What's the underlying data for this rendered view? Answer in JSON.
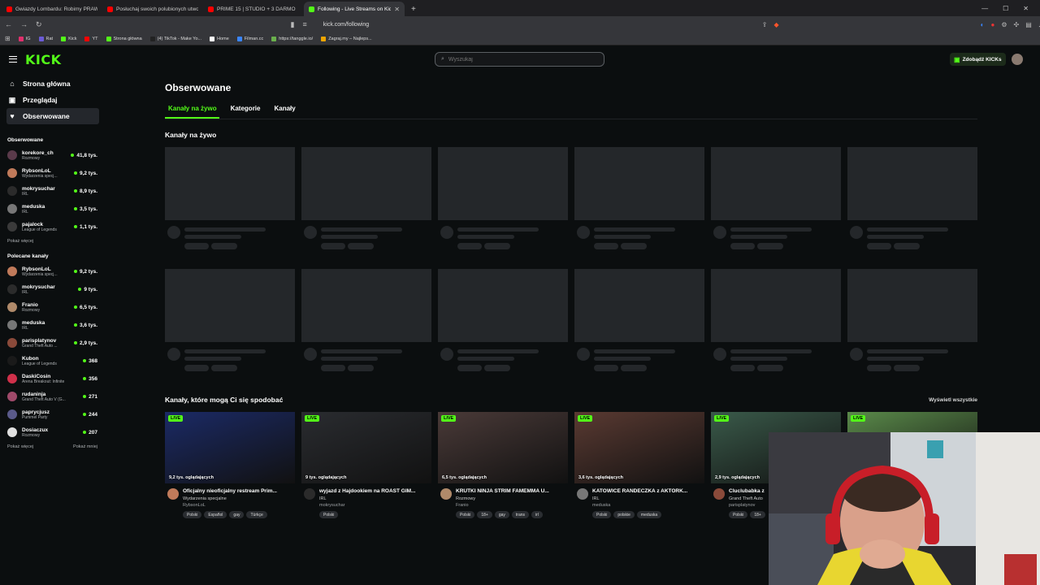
{
  "browser": {
    "tabs": [
      {
        "title": "Gwiazdy Lombardu: Robimy PRAWO",
        "color": "#ff0000",
        "active": false
      },
      {
        "title": "Posłuchaj swoich polubionych utwo",
        "color": "#ff0000",
        "active": false
      },
      {
        "title": "PRIME 15 | STUDIO + 3 DARMO",
        "color": "#ff0000",
        "active": false
      },
      {
        "title": "Following - Live Streams on Kick",
        "color": "#53fc18",
        "active": true
      }
    ],
    "url": "kick.com/following",
    "bookmarks": [
      {
        "label": "IG",
        "color": "#e1306c"
      },
      {
        "label": "Rat",
        "color": "#6b5bd6"
      },
      {
        "label": "Kick",
        "color": "#53fc18"
      },
      {
        "label": "YT",
        "color": "#ff0000"
      },
      {
        "label": "Strona główna",
        "color": "#53fc18"
      },
      {
        "label": "(4) TikTok - Make Yo...",
        "color": "#222222"
      },
      {
        "label": "Home",
        "color": "#ffffff"
      },
      {
        "label": "Filman.cc",
        "color": "#3a86ff"
      },
      {
        "label": "https://tanggle.io/",
        "color": "#6ab04c"
      },
      {
        "label": "Zagraj.my – Najleps...",
        "color": "#f0a500"
      }
    ]
  },
  "header": {
    "logo": "KICK",
    "search_placeholder": "Wyszukaj",
    "kicks_button": "Zdobądź KICKs"
  },
  "sidebar": {
    "nav": [
      {
        "label": "Strona główna",
        "icon": "home-icon",
        "glyph": "⌂",
        "active": false
      },
      {
        "label": "Przeglądaj",
        "icon": "browse-icon",
        "glyph": "▣",
        "active": false
      },
      {
        "label": "Obserwowane",
        "icon": "heart-icon",
        "glyph": "♥",
        "active": true
      }
    ],
    "followed_title": "Obserwowane",
    "followed": [
      {
        "name": "korekore_ch",
        "category": "Rozmowy",
        "viewers": "41,8 tys.",
        "color": "#5a3a4a"
      },
      {
        "name": "RybsonLoL",
        "category": "Wydarzenia specj...",
        "viewers": "9,2 tys.",
        "color": "#c07a5a"
      },
      {
        "name": "mokrysuchar",
        "category": "IRL",
        "viewers": "8,9 tys.",
        "color": "#2b2b2b"
      },
      {
        "name": "meduska",
        "category": "IRL",
        "viewers": "3,5 tys.",
        "color": "#777777"
      },
      {
        "name": "pajalock",
        "category": "League of Legends",
        "viewers": "1,1 tys.",
        "color": "#3a3a3a"
      }
    ],
    "followed_more": "Pokaż więcej",
    "recommended_title": "Polecane kanały",
    "recommended": [
      {
        "name": "RybsonLoL",
        "category": "Wydarzenia specj...",
        "viewers": "9,2 tys.",
        "color": "#c07a5a"
      },
      {
        "name": "mokrysuchar",
        "category": "IRL",
        "viewers": "9 tys.",
        "color": "#2b2b2b"
      },
      {
        "name": "Franio",
        "category": "Rozmowy",
        "viewers": "6,5 tys.",
        "color": "#b08a6a"
      },
      {
        "name": "meduska",
        "category": "IRL",
        "viewers": "3,6 tys.",
        "color": "#777777"
      },
      {
        "name": "parisplatynov",
        "category": "Grand Theft Auto ...",
        "viewers": "2,9 tys.",
        "color": "#8a4a3a"
      },
      {
        "name": "Kubon",
        "category": "League of Legends",
        "viewers": "368",
        "color": "#1a1a1a"
      },
      {
        "name": "DaskiCosin",
        "category": "Arena Breakout: Infinite",
        "viewers": "356",
        "color": "#d0304a"
      },
      {
        "name": "rudaninja",
        "category": "Grand Theft Auto V (G...",
        "viewers": "271",
        "color": "#a04a6a"
      },
      {
        "name": "paprycjusz",
        "category": "Pummel Party",
        "viewers": "244",
        "color": "#5a5a8a"
      },
      {
        "name": "Dosiaczux",
        "category": "Rozmowy",
        "viewers": "207",
        "color": "#e0e0e0"
      }
    ],
    "recommended_more": "Pokaż więcej",
    "recommended_less": "Pokaż mniej"
  },
  "main": {
    "title": "Obserwowane",
    "tabs": [
      "Kanały na żywo",
      "Kategorie",
      "Kanały"
    ],
    "live_section_title": "Kanały na żywo",
    "reco_section_title": "Kanały, które mogą Ci się spodobać",
    "see_all": "Wyświetl wszystkie",
    "live_badge": "LIVE",
    "cards": [
      {
        "views": "9,2 tys. oglądających",
        "title": "Oficjalny nieoficjalny restream Prim...",
        "category": "Wydarzenia specjalne",
        "channel": "RybsonLoL",
        "tags": [
          "Polski",
          "Español",
          "gay",
          "Türkçe"
        ],
        "avatar": "#c07a5a",
        "thumb": "#1b2a66"
      },
      {
        "views": "9 tys. oglądających",
        "title": "wyjazd z Hajdookiem na ROAST GIM...",
        "category": "IRL",
        "channel": "mokrysuchar",
        "tags": [
          "Polski"
        ],
        "avatar": "#2b2b2b",
        "thumb": "#2a2c30"
      },
      {
        "views": "6,5 tys. oglądających",
        "title": "KRUTKI NINJA STRIM FAMEMMA U...",
        "category": "Rozmowy",
        "channel": "Franio",
        "tags": [
          "Polski",
          "18+",
          "gay",
          "trans",
          "irl"
        ],
        "avatar": "#b08a6a",
        "thumb": "#4a3a38"
      },
      {
        "views": "3,6 tys. oglądających",
        "title": "KATOWICE RANDECZKA z AKTORK...",
        "category": "IRL",
        "channel": "meduska",
        "tags": [
          "Polski",
          "polskie",
          "meduska"
        ],
        "avatar": "#777777",
        "thumb": "#5a3a32"
      },
      {
        "views": "2,9 tys. oglądających",
        "title": "Cluclubabka z",
        "category": "Grand Theft Auto",
        "channel": "parisplatynov",
        "tags": [
          "Polski",
          "18+"
        ],
        "avatar": "#8a4a3a",
        "thumb": "#3a5a4a"
      },
      {
        "views": "",
        "title": "",
        "category": "",
        "channel": "",
        "tags": [],
        "avatar": "#444444",
        "thumb": "#5a8a4a"
      }
    ]
  }
}
